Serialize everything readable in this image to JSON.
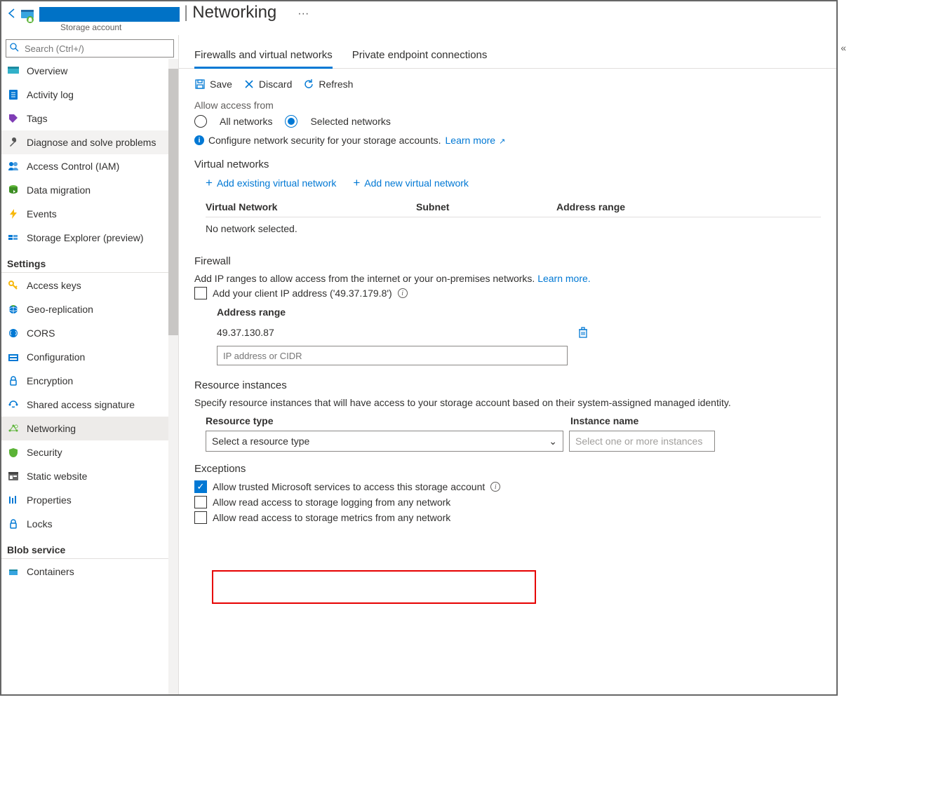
{
  "header": {
    "page_title": "Networking",
    "subtitle": "Storage account"
  },
  "sidebar": {
    "search_placeholder": "Search (Ctrl+/)",
    "top_items": [
      {
        "icon": "overview",
        "label": "Overview"
      },
      {
        "icon": "activity",
        "label": "Activity log"
      },
      {
        "icon": "tags",
        "label": "Tags"
      },
      {
        "icon": "diagnose",
        "label": "Diagnose and solve problems"
      },
      {
        "icon": "access",
        "label": "Access Control (IAM)"
      },
      {
        "icon": "migration",
        "label": "Data migration"
      },
      {
        "icon": "events",
        "label": "Events"
      },
      {
        "icon": "explorer",
        "label": "Storage Explorer (preview)"
      }
    ],
    "settings_label": "Settings",
    "settings_items": [
      {
        "icon": "keys",
        "label": "Access keys"
      },
      {
        "icon": "geo",
        "label": "Geo-replication"
      },
      {
        "icon": "cors",
        "label": "CORS"
      },
      {
        "icon": "config",
        "label": "Configuration"
      },
      {
        "icon": "encryption",
        "label": "Encryption"
      },
      {
        "icon": "sas",
        "label": "Shared access signature"
      },
      {
        "icon": "networking",
        "label": "Networking"
      },
      {
        "icon": "security",
        "label": "Security"
      },
      {
        "icon": "static",
        "label": "Static website"
      },
      {
        "icon": "properties",
        "label": "Properties"
      },
      {
        "icon": "locks",
        "label": "Locks"
      }
    ],
    "blob_label": "Blob service",
    "blob_items": [
      {
        "icon": "containers",
        "label": "Containers"
      }
    ]
  },
  "tabs": {
    "firewalls": "Firewalls and virtual networks",
    "private": "Private endpoint connections"
  },
  "toolbar": {
    "save": "Save",
    "discard": "Discard",
    "refresh": "Refresh"
  },
  "access": {
    "label": "Allow access from",
    "all": "All networks",
    "selected": "Selected networks",
    "info": "Configure network security for your storage accounts.",
    "learn": "Learn more"
  },
  "vnet": {
    "heading": "Virtual networks",
    "add_existing": "Add existing virtual network",
    "add_new": "Add new virtual network",
    "col_network": "Virtual Network",
    "col_subnet": "Subnet",
    "col_range": "Address range",
    "empty": "No network selected."
  },
  "firewall": {
    "heading": "Firewall",
    "desc": "Add IP ranges to allow access from the internet or your on-premises networks.",
    "learn": "Learn more.",
    "client_ip": "Add your client IP address ('49.37.179.8')",
    "col_range": "Address range",
    "ip_value": "49.37.130.87",
    "placeholder": "IP address or CIDR"
  },
  "resource": {
    "heading": "Resource instances",
    "desc": "Specify resource instances that will have access to your storage account based on their system-assigned managed identity.",
    "col_type": "Resource type",
    "col_name": "Instance name",
    "type_placeholder": "Select a resource type",
    "name_placeholder": "Select one or more instances"
  },
  "exceptions": {
    "heading": "Exceptions",
    "opt1": "Allow trusted Microsoft services to access this storage account",
    "opt2": "Allow read access to storage logging from any network",
    "opt3": "Allow read access to storage metrics from any network"
  }
}
